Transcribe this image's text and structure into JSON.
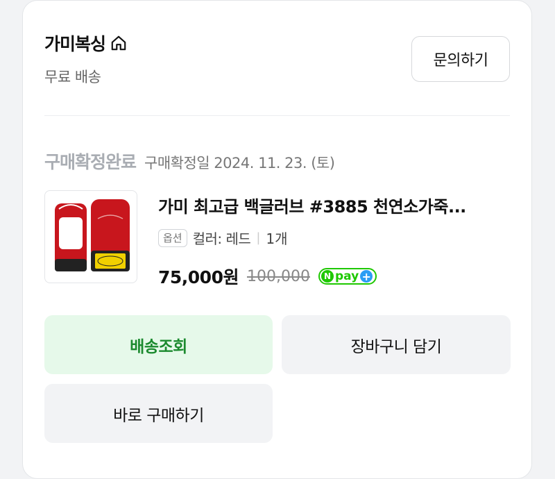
{
  "seller": {
    "name": "가미복싱",
    "shipping": "무료 배송",
    "inquiry_label": "문의하기"
  },
  "order": {
    "status": "구매확정완료",
    "confirm_date": "구매확정일 2024. 11. 23. (토)"
  },
  "product": {
    "title": "가미 최고급 백글러브 #3885 천연소가죽...",
    "option_badge": "옵션",
    "option": "컬러: 레드",
    "separator": "|",
    "quantity": "1개",
    "price": "75,000원",
    "original_price": "100,000",
    "pay_badge": {
      "n": "N",
      "text": "pay",
      "plus": "+"
    }
  },
  "actions": {
    "track_label": "배송조회",
    "cart_label": "장바구니 담기",
    "buy_label": "바로 구매하기"
  },
  "colors": {
    "accent_green": "#1b8a2e",
    "track_bg": "#e6f9ea",
    "npay_green": "#1ec800",
    "npay_blue": "#2a9df4"
  },
  "icons": {
    "home": "home-icon",
    "product_image": "red-bag-gloves-image"
  }
}
